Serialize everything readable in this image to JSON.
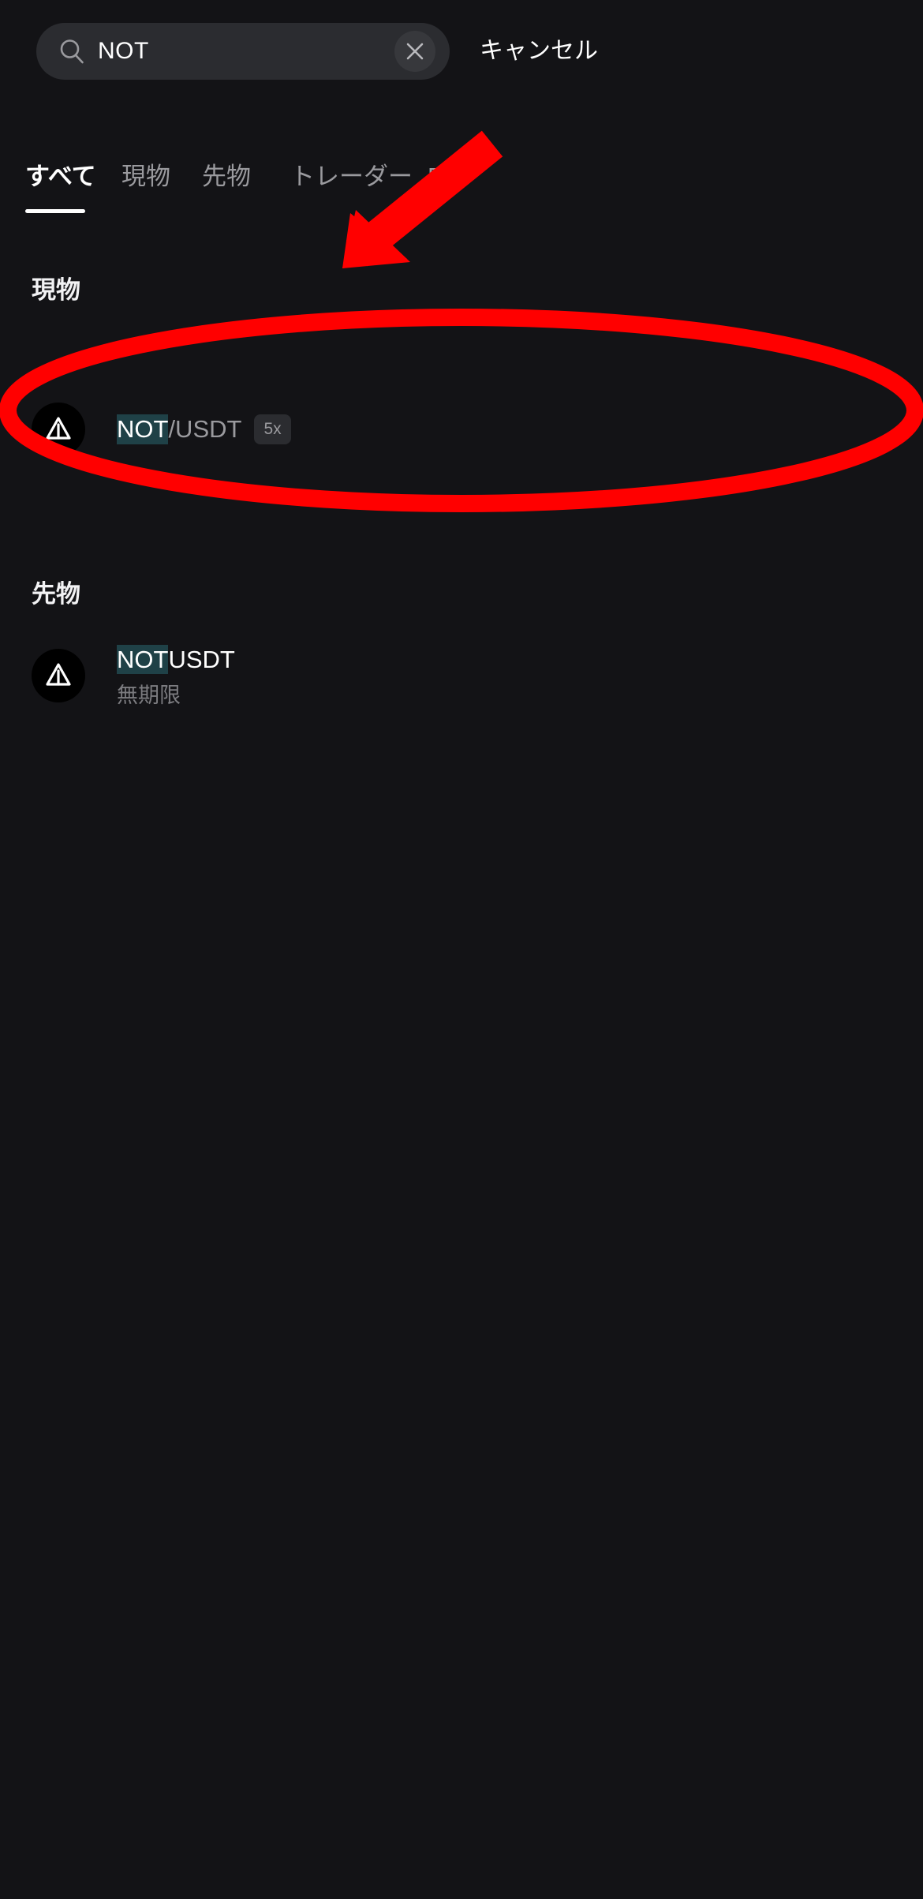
{
  "search": {
    "icon": "search-icon",
    "value": "NOT",
    "placeholder": "NOT",
    "clear_icon": "close-icon",
    "cancel_label": "キャンセル"
  },
  "tabs": {
    "items": [
      {
        "label": "すべて",
        "active": true
      },
      {
        "label": "現物",
        "active": false
      },
      {
        "label": "先物",
        "active": false
      },
      {
        "label": "トレーダー",
        "active": false
      },
      {
        "label": "Bot",
        "active": false
      }
    ]
  },
  "sections": [
    {
      "title": "現物",
      "rows": [
        {
          "logo_icon": "notcoin-logo-icon",
          "base": "NOT",
          "quote": "/USDT",
          "leverage_badge": "5x",
          "sub_label": ""
        }
      ]
    },
    {
      "title": "先物",
      "rows": [
        {
          "logo_icon": "notcoin-logo-icon",
          "base": "NOT",
          "quote": "USDT",
          "leverage_badge": "",
          "sub_label": "無期限"
        }
      ]
    }
  ],
  "colors": {
    "background": "#131316",
    "search_field": "#2b2c30",
    "highlight": "#1f4147",
    "annotation": "#ff0000",
    "muted_text": "#9a9a9e",
    "primary_text": "#ffffff"
  },
  "annotations": {
    "arrow": "red-arrow-annotation",
    "ellipse": "red-ellipse-annotation"
  }
}
